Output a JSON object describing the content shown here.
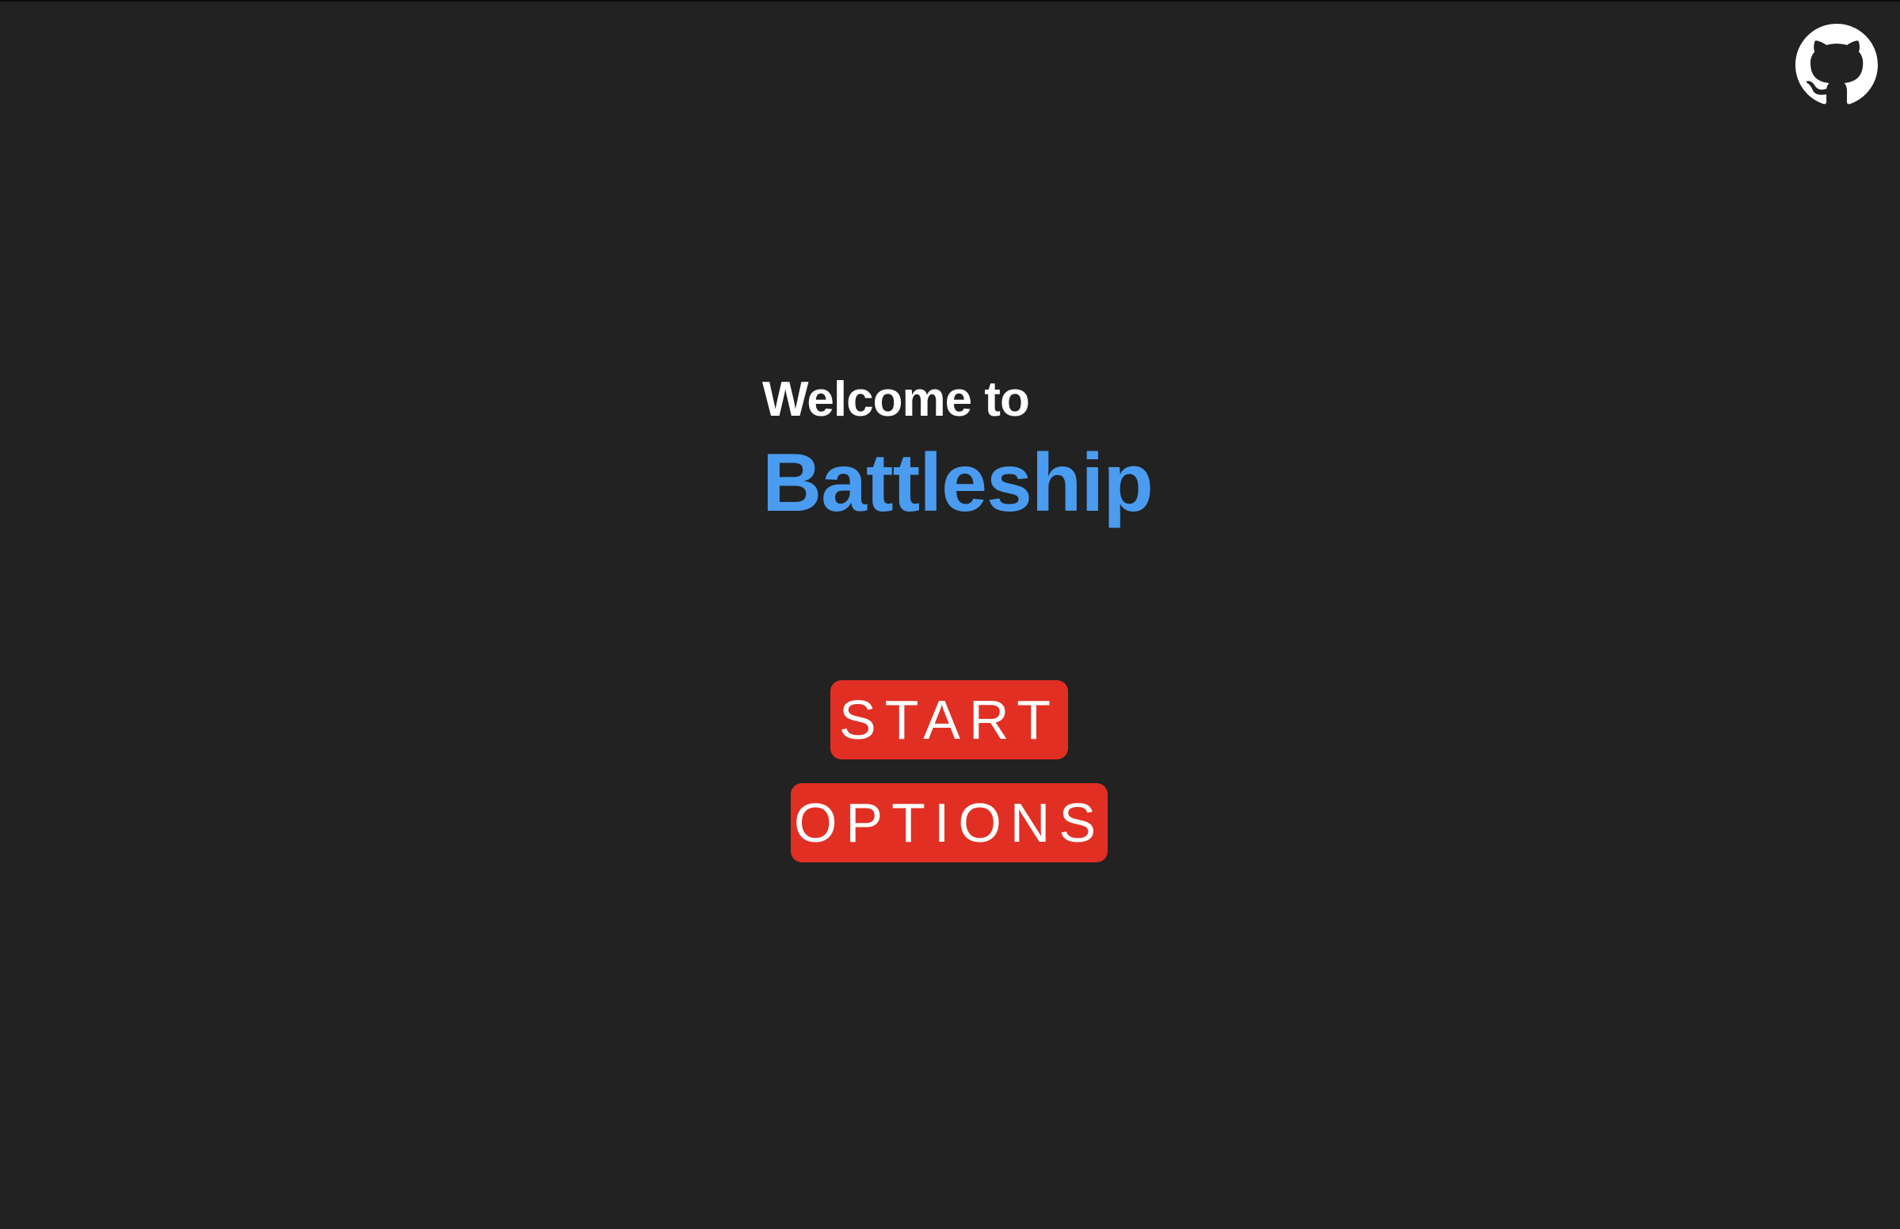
{
  "header": {
    "github_icon": "github-icon",
    "github_icon_color": "#ffffff"
  },
  "title": {
    "welcome_text": "Welcome to",
    "game_name": "Battleship",
    "game_name_color": "#4a9cf0"
  },
  "menu": {
    "start_label": "START",
    "options_label": "OPTIONS",
    "button_color": "#e22f23"
  },
  "theme": {
    "background": "#222222",
    "text": "#ffffff"
  }
}
